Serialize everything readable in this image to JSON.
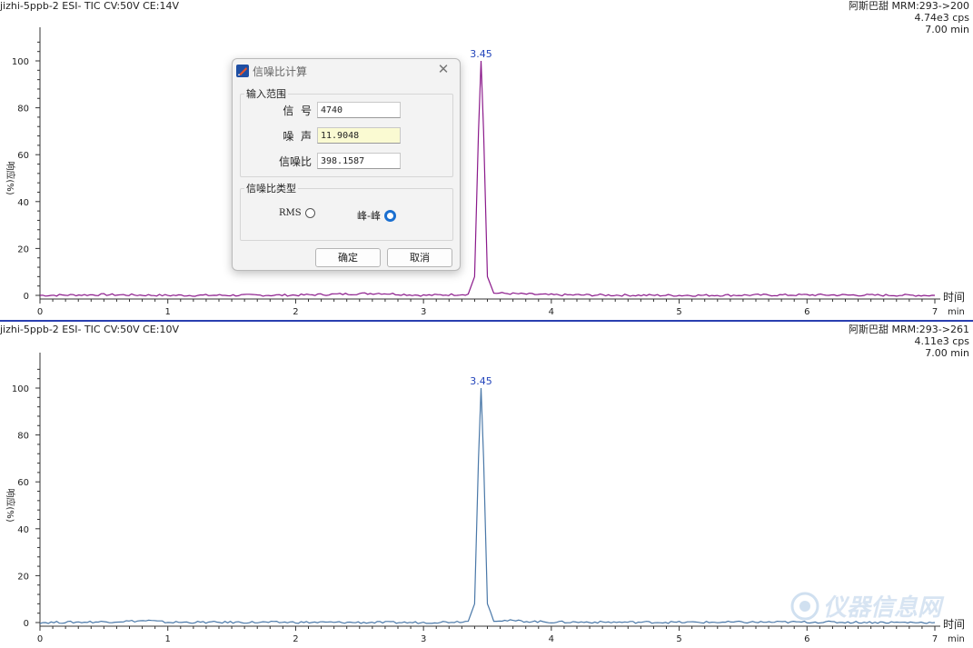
{
  "top_panel": {
    "header_left": "jizhi-5ppb-2 ESI- TIC CV:50V CE:14V",
    "header_right": [
      "阿斯巴甜 MRM:293->200",
      "4.74e3 cps",
      "7.00 min"
    ],
    "y_label": "响应(%)",
    "x_unit_label": "时间",
    "x_unit_sub": "min",
    "peak_label": "3.45",
    "line_color": "#8b1a8b"
  },
  "bottom_panel": {
    "header_left": "jizhi-5ppb-2 ESI- TIC CV:50V CE:10V",
    "header_right": [
      "阿斯巴甜 MRM:293->261",
      "4.11e3 cps",
      "7.00 min"
    ],
    "y_label": "响应(%)",
    "x_unit_label": "时间",
    "x_unit_sub": "min",
    "peak_label": "3.45",
    "line_color": "#4a78a8"
  },
  "x_ticks": [
    "0",
    "1",
    "2",
    "3",
    "4",
    "5",
    "6",
    "7"
  ],
  "y_ticks": [
    "0",
    "20",
    "40",
    "60",
    "80",
    "100"
  ],
  "peak_label_color": "#2244bb",
  "dialog": {
    "title": "信噪比计算",
    "input_group": "输入范围",
    "signal_label": "信  号",
    "signal_value": "4740",
    "noise_label": "噪  声",
    "noise_value": "11.9048",
    "snr_label": "信噪比",
    "snr_value": "398.1587",
    "type_group": "信噪比类型",
    "rms_label": "RMS",
    "pp_label": "峰-峰",
    "selected": "峰-峰",
    "ok_label": "确定",
    "cancel_label": "取消"
  },
  "watermark": "仪器信息网",
  "chart_data": [
    {
      "type": "line",
      "title": "jizhi-5ppb-2 ESI- TIC CV:50V CE:14V",
      "xlabel": "时间 min",
      "ylabel": "响应(%)",
      "xlim": [
        0,
        7
      ],
      "ylim": [
        0,
        100
      ],
      "series": [
        {
          "name": "阿斯巴甜 MRM:293->200",
          "x": [
            0,
            0.5,
            1.0,
            2.0,
            2.65,
            3.0,
            3.35,
            3.4,
            3.43,
            3.45,
            3.47,
            3.5,
            3.55,
            4.0,
            5.0,
            6.0,
            7.0
          ],
          "y": [
            0,
            0.3,
            0,
            0.1,
            0.9,
            0,
            0.5,
            8,
            70,
            100,
            70,
            8,
            1,
            0.2,
            0,
            0.2,
            0
          ]
        }
      ],
      "annotations": [
        "3.45"
      ]
    },
    {
      "type": "line",
      "title": "jizhi-5ppb-2 ESI- TIC CV:50V CE:10V",
      "xlabel": "时间 min",
      "ylabel": "响应(%)",
      "xlim": [
        0,
        7
      ],
      "ylim": [
        0,
        100
      ],
      "series": [
        {
          "name": "阿斯巴甜 MRM:293->261",
          "x": [
            0,
            0.5,
            0.85,
            1.0,
            2.0,
            3.0,
            3.35,
            3.4,
            3.43,
            3.45,
            3.47,
            3.5,
            3.55,
            4.0,
            5.0,
            6.0,
            7.0
          ],
          "y": [
            0,
            0.3,
            0.8,
            0.1,
            0.1,
            0,
            0.5,
            8,
            70,
            100,
            70,
            8,
            1,
            0.2,
            0.1,
            0.2,
            0
          ]
        }
      ],
      "annotations": [
        "3.45"
      ]
    }
  ]
}
